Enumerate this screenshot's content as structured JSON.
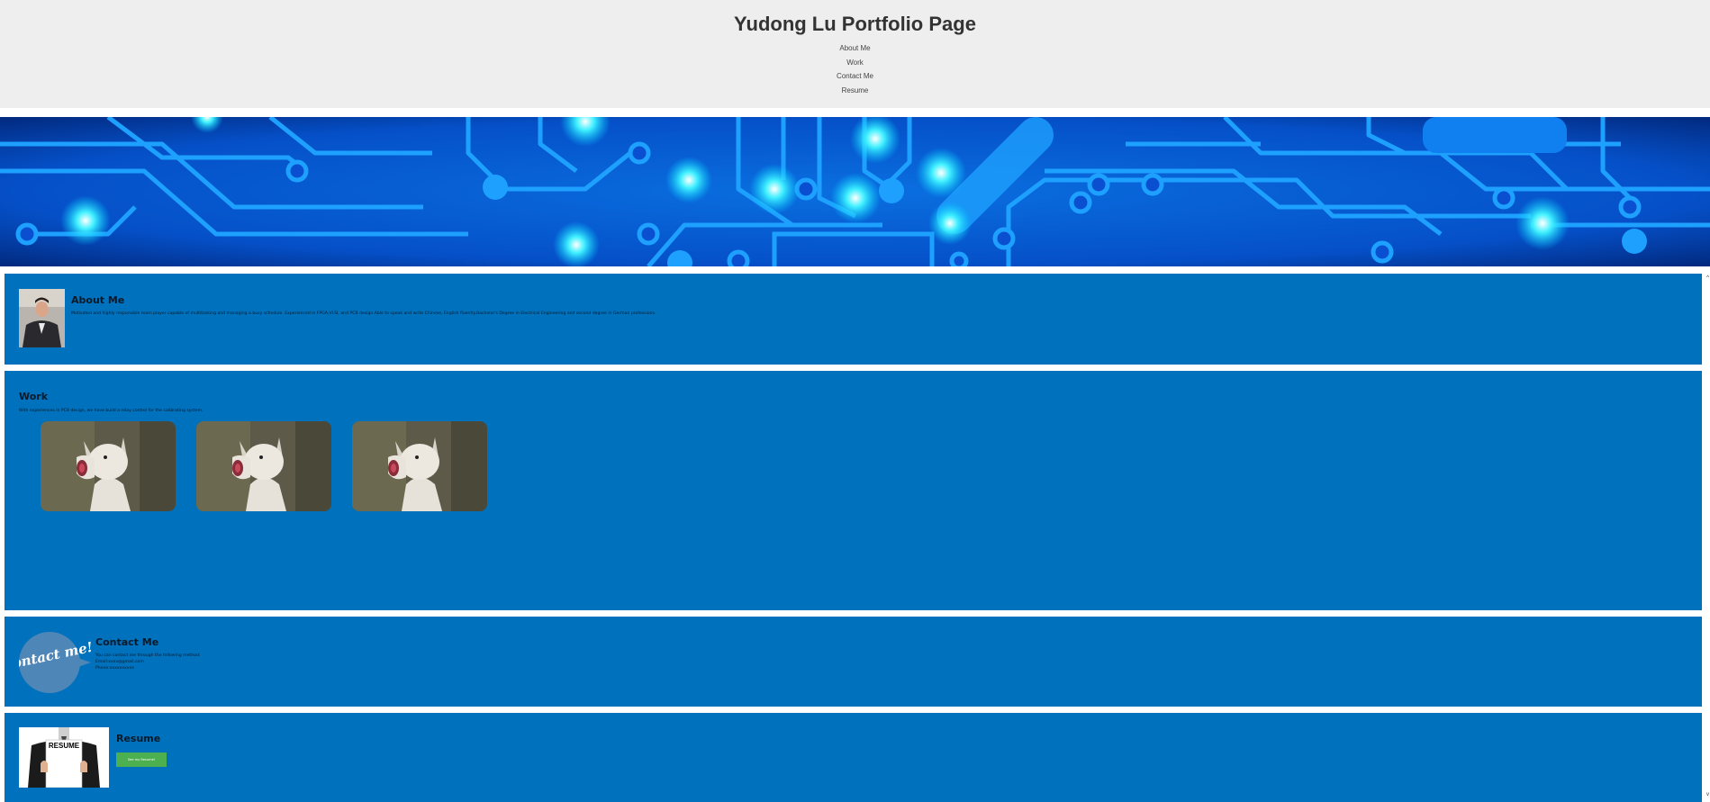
{
  "header": {
    "title": "Yudong Lu Portfolio Page",
    "nav": [
      "About Me",
      "Work",
      "Contact Me",
      "Resume"
    ]
  },
  "about": {
    "title": "About Me",
    "text": "Motivated and highly responsible team player capable of multitasking and managing a busy schedule. Experienced in FPGA,VLSI, and PCB design.Able to speak and write Chinese, English fluently.Bachelor's Degree in Electrical Engineering and second degree in German professions."
  },
  "work": {
    "title": "Work",
    "text": "With experiences in PCB design, we have build a relay control for the calibrating system."
  },
  "contact": {
    "title": "Contact Me",
    "intro": "You can contact me through the following method:",
    "email": "Email:xxxx@gmail.com",
    "phone": "Phone:xxxxxxxxxx",
    "badge_text": "Contact me!"
  },
  "resume": {
    "title": "Resume",
    "button_label": "See my Resume!",
    "sign_text": "RESUME"
  },
  "colors": {
    "header_bg": "#eeeeee",
    "section_bg": "#0071bc",
    "banner_bg": "#0050c8",
    "button_bg": "#4caf50"
  }
}
